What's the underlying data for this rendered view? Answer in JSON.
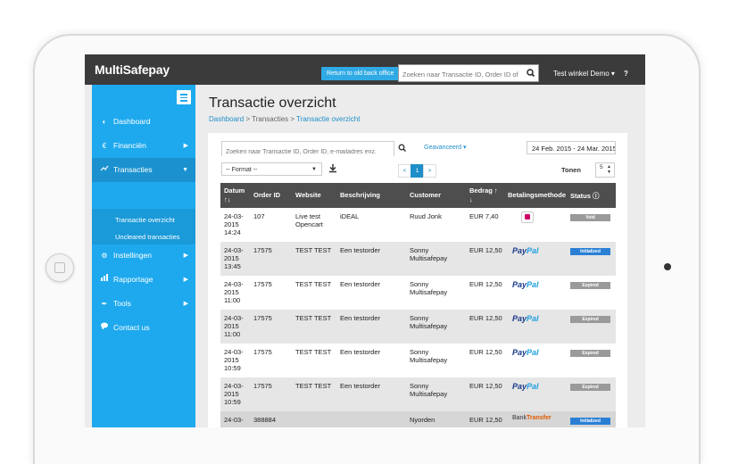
{
  "app": {
    "logo": "MultiSafepay",
    "return_button": "Return to old back office",
    "top_search_placeholder": "Zoeken naar Transactie ID, Order ID of b",
    "shop_menu": "Test winkel Demo ▾",
    "help": "?"
  },
  "sidebar": {
    "items": [
      {
        "label": "Dashboard",
        "icon": "dashboard-icon",
        "arrow": ""
      },
      {
        "label": "Financiën",
        "icon": "euro-icon",
        "arrow": "▶"
      },
      {
        "label": "Transacties",
        "icon": "chart-line-icon",
        "arrow": "▼"
      },
      {
        "label": "Instellingen",
        "icon": "gears-icon",
        "arrow": "▶"
      },
      {
        "label": "Rapportage",
        "icon": "bar-chart-icon",
        "arrow": "▶"
      },
      {
        "label": "Tools",
        "icon": "wrench-icon",
        "arrow": "▶"
      },
      {
        "label": "Contact us",
        "icon": "chat-bubble-icon",
        "arrow": ""
      }
    ],
    "sub_items": [
      "Transactie overzicht",
      "Uncleared transacties"
    ]
  },
  "page": {
    "title": "Transactie overzicht",
    "breadcrumb": {
      "home": "Dashboard",
      "sep1": " > ",
      "section": "Transacties",
      "sep2": " > ",
      "current": "Transactie overzicht"
    }
  },
  "filters": {
    "search_placeholder": "Zoeken naar Transactie ID, Order ID, e-mailadres enz.",
    "advanced": "Geavanceerd ▾",
    "date_range": "24 Feb. 2015 - 24 Mar. 2015",
    "format": "-- Format --",
    "pager": [
      "<",
      "1",
      ">"
    ],
    "tonen_label": "Tonen",
    "tonen_value": "5"
  },
  "table": {
    "headers": {
      "datum": "Datum",
      "datum_sort": "↑↓",
      "order_id": "Order ID",
      "website": "Website",
      "beschrijving": "Beschrijving",
      "customer": "Customer",
      "bedrag": "Bedrag ↑",
      "bedrag_sort": "↓",
      "betalingsmethode": "Betalingsmethode",
      "status": "Status"
    },
    "rows": [
      {
        "d1": "24-03-",
        "d2": "2015",
        "d3": "14:24",
        "order": "107",
        "web1": "Live test",
        "web2": "Opencart",
        "desc": "iDEAL",
        "cust1": "Ruud Jonk",
        "cust2": "",
        "amount": "EUR 7,40",
        "status": "Void",
        "method": "ideal"
      },
      {
        "d1": "24-03-",
        "d2": "2015",
        "d3": "13:45",
        "order": "17575",
        "web1": "TEST TEST",
        "web2": "",
        "desc": "Een testorder",
        "cust1": "Sonny",
        "cust2": "Multisafepay",
        "amount": "EUR 12,50",
        "status": "Initialized",
        "method": "paypal"
      },
      {
        "d1": "24-03-",
        "d2": "2015",
        "d3": "11:00",
        "order": "17575",
        "web1": "TEST TEST",
        "web2": "",
        "desc": "Een testorder",
        "cust1": "Sonny",
        "cust2": "Multisafepay",
        "amount": "EUR 12,50",
        "status": "Expired",
        "method": "paypal"
      },
      {
        "d1": "24-03-",
        "d2": "2015",
        "d3": "11:00",
        "order": "17575",
        "web1": "TEST TEST",
        "web2": "",
        "desc": "Een testorder",
        "cust1": "Sonny",
        "cust2": "Multisafepay",
        "amount": "EUR 12,50",
        "status": "Expired",
        "method": "paypal"
      },
      {
        "d1": "24-03-",
        "d2": "2015",
        "d3": "10:59",
        "order": "17575",
        "web1": "TEST TEST",
        "web2": "",
        "desc": "Een testorder",
        "cust1": "Sonny",
        "cust2": "Multisafepay",
        "amount": "EUR 12,50",
        "status": "Expired",
        "method": "paypal"
      },
      {
        "d1": "24-03-",
        "d2": "2015",
        "d3": "10:59",
        "order": "17575",
        "web1": "TEST TEST",
        "web2": "",
        "desc": "Een testorder",
        "cust1": "Sonny",
        "cust2": "Multisafepay",
        "amount": "EUR 12,50",
        "status": "Expired",
        "method": "paypal"
      },
      {
        "d1": "24-03-",
        "d2": "",
        "d3": "",
        "order": "388884",
        "web1": "",
        "web2": "",
        "desc": "",
        "cust1": "Nyorden",
        "cust2": "",
        "amount": "EUR 12,50",
        "status": "Initialized",
        "method": "bank"
      }
    ],
    "paypal_a": "Pay",
    "paypal_b": "Pal",
    "bank_a": "Bank",
    "bank_b": "Transfer"
  },
  "colors": {
    "accent": "#1ea9ee",
    "topbar": "#3b3b3b",
    "void": "#9a9a9a",
    "initialized": "#2a7fd4",
    "expired": "#9a9a9a"
  }
}
